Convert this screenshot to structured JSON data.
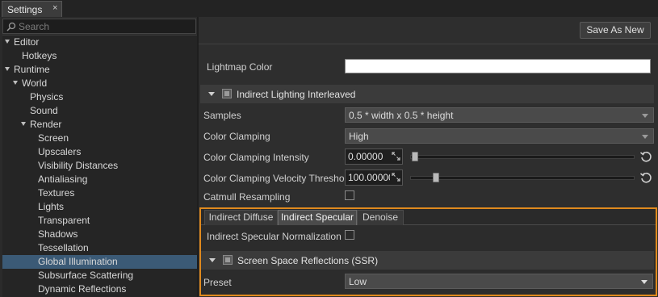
{
  "window": {
    "tab_title": "Settings",
    "tab_close": "×"
  },
  "search": {
    "placeholder": "Search"
  },
  "tree": [
    {
      "label": "Editor",
      "expanded": true
    },
    {
      "label": "Hotkeys"
    },
    {
      "label": "Runtime",
      "expanded": true
    },
    {
      "label": "World",
      "expanded": true
    },
    {
      "label": "Physics"
    },
    {
      "label": "Sound"
    },
    {
      "label": "Render",
      "expanded": true
    },
    {
      "label": "Screen"
    },
    {
      "label": "Upscalers"
    },
    {
      "label": "Visibility Distances"
    },
    {
      "label": "Antialiasing"
    },
    {
      "label": "Textures"
    },
    {
      "label": "Lights"
    },
    {
      "label": "Transparent"
    },
    {
      "label": "Shadows"
    },
    {
      "label": "Tessellation"
    },
    {
      "label": "Global Illumination",
      "selected": true
    },
    {
      "label": "Subsurface Scattering"
    },
    {
      "label": "Dynamic Reflections"
    }
  ],
  "toolbar": {
    "save_as_new": "Save As New"
  },
  "lightmap": {
    "label": "Lightmap Color",
    "color": "#ffffff"
  },
  "interleaved": {
    "title": "Indirect Lighting Interleaved",
    "samples_label": "Samples",
    "samples_value": "0.5 * width x 0.5 * height",
    "color_clamping_label": "Color Clamping",
    "color_clamping_value": "High",
    "intensity_label": "Color Clamping Intensity",
    "intensity_value": "0.00000",
    "velocity_label": "Color Clamping Velocity Threshold",
    "velocity_value": "100.00000",
    "catmull_label": "Catmull Resampling"
  },
  "subtabs": {
    "diffuse": "Indirect Diffuse",
    "specular": "Indirect Specular",
    "denoise": "Denoise"
  },
  "specular": {
    "normalization_label": "Indirect Specular Normalization",
    "ssr_title": "Screen Space Reflections (SSR)",
    "preset_label": "Preset",
    "preset_value": "Low"
  },
  "colors": {
    "accent_highlight": "#e08a1e",
    "selection": "#3b5a76"
  }
}
